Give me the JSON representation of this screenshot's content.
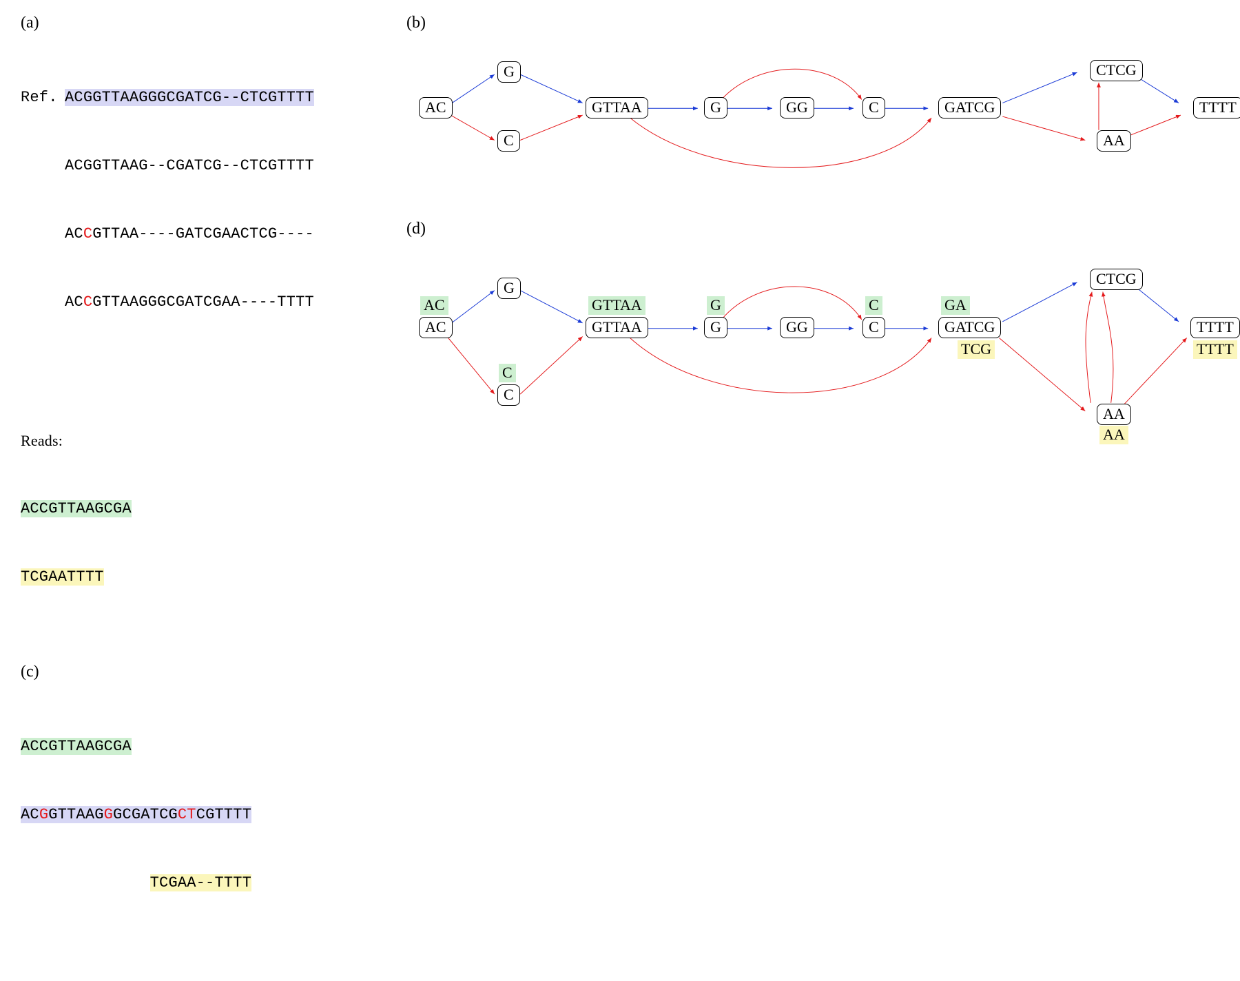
{
  "labels": {
    "a": "(a)",
    "b": "(b)",
    "c": "(c)",
    "d": "(d)",
    "ref": "Ref.",
    "reads": "Reads:"
  },
  "alignment": {
    "ref_pre": "AC",
    "ref_hl": "G",
    "ref_tail": "GTTAAGGGCGATCG--CTCGTTTT",
    "row2": "ACGGTTAAG--CGATCG--CTCGTTTT",
    "row3_pre": "AC",
    "row3_snp": "C",
    "row3_tail": "GTTAA----GATCGAACTCG----",
    "row4_pre": "AC",
    "row4_snp": "C",
    "row4_tail": "GTTAAGGGCGATCGAA----TTTT",
    "read1": "ACCGTTAAGCGA",
    "read2": "TCGAATTTT"
  },
  "panel_c": {
    "read_top": "ACCGTTAAGCGA",
    "ref_pre": "AC",
    "ref_s1": "G",
    "ref_m1": "GTTAAG",
    "ref_s2": "G",
    "ref_m2": "GC",
    "ref_s3": "",
    "ref_m3": "GATCG",
    "ref_s4": "CT",
    "ref_m4": "CGTTTT",
    "read_bot_pad": "              ",
    "read_bot": "TCGAA--TTTT"
  },
  "graph": {
    "nodes": {
      "ac": "AC",
      "g1": "G",
      "c1": "C",
      "gttaa": "GTTAA",
      "g2": "G",
      "gg": "GG",
      "c2": "C",
      "gatcg": "GATCG",
      "ctcg": "CTCG",
      "aa": "AA",
      "tttt": "TTTT"
    }
  },
  "annotations_d": {
    "ac": "AC",
    "c": "C",
    "gttaa": "GTTAA",
    "g": "G",
    "c2": "C",
    "ga": "GA",
    "tcg": "TCG",
    "aa": "AA",
    "tttt": "TTTT"
  },
  "chart_data": {
    "type": "diagram",
    "panels": {
      "b": {
        "nodes": [
          "AC",
          "G",
          "C",
          "GTTAA",
          "G",
          "GG",
          "C",
          "GATCG",
          "CTCG",
          "AA",
          "TTTT"
        ],
        "edges": [
          {
            "from": "AC",
            "to": "G",
            "color": "blue"
          },
          {
            "from": "AC",
            "to": "C",
            "color": "red"
          },
          {
            "from": "G",
            "to": "GTTAA",
            "color": "blue"
          },
          {
            "from": "C",
            "to": "GTTAA",
            "color": "red"
          },
          {
            "from": "GTTAA",
            "to": "G",
            "color": "blue"
          },
          {
            "from": "GTTAA",
            "to": "GATCG",
            "color": "red"
          },
          {
            "from": "G",
            "to": "GG",
            "color": "blue"
          },
          {
            "from": "G",
            "to": "C",
            "color": "red"
          },
          {
            "from": "GG",
            "to": "C",
            "color": "blue"
          },
          {
            "from": "C",
            "to": "GATCG",
            "color": "blue"
          },
          {
            "from": "GATCG",
            "to": "CTCG",
            "color": "blue"
          },
          {
            "from": "GATCG",
            "to": "AA",
            "color": "red"
          },
          {
            "from": "CTCG",
            "to": "TTTT",
            "color": "blue"
          },
          {
            "from": "AA",
            "to": "TTTT",
            "color": "red"
          },
          {
            "from": "AA",
            "to": "CTCG",
            "color": "red"
          }
        ]
      },
      "d_annotations": {
        "green": {
          "AC": "AC",
          "C": "C",
          "GTTAA": "GTTAA",
          "G": "G",
          "C2": "C",
          "GATCG": "GA"
        },
        "yellow": {
          "GATCG": "TCG",
          "AA": "AA",
          "TTTT": "TTTT"
        }
      }
    }
  }
}
